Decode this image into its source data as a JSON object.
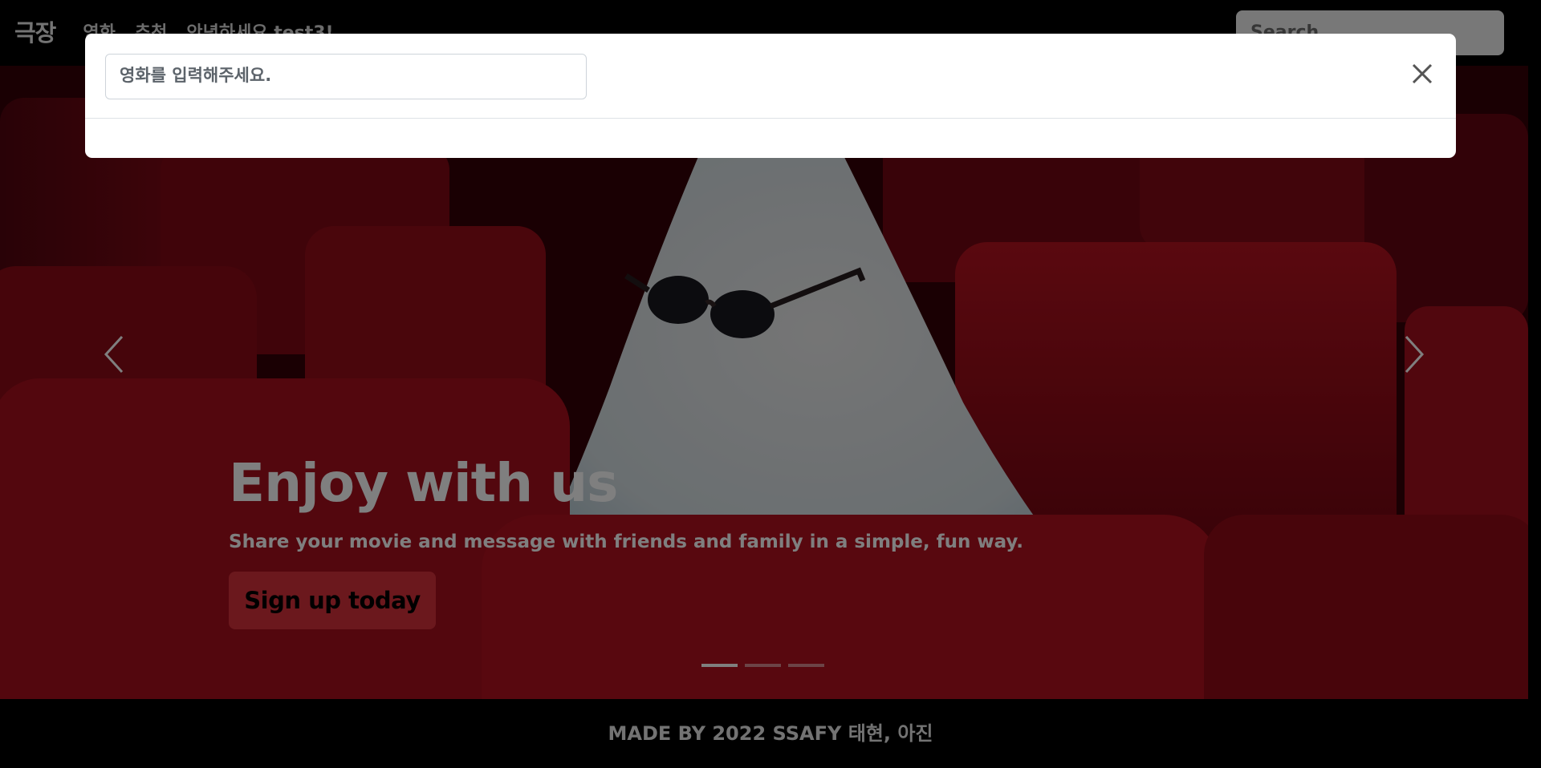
{
  "navbar": {
    "brand": "극장",
    "links": [
      "영화",
      "추천",
      "안녕하세요 test3!"
    ],
    "search_placeholder": "Search"
  },
  "hero": {
    "title": "Enjoy with us",
    "subtitle": "Share your movie and message with friends and family in a simple, fun way.",
    "button_label": "Sign up today",
    "slide_count": 3,
    "active_slide": 1,
    "colors": {
      "button": "#d6303b",
      "seat_red": "#a80e1c"
    }
  },
  "search_modal": {
    "input_placeholder": "영화를 입력해주세요.",
    "close_icon": "close-icon"
  },
  "footer": {
    "text": "MADE BY 2022 SSAFY 태현, 아진"
  }
}
